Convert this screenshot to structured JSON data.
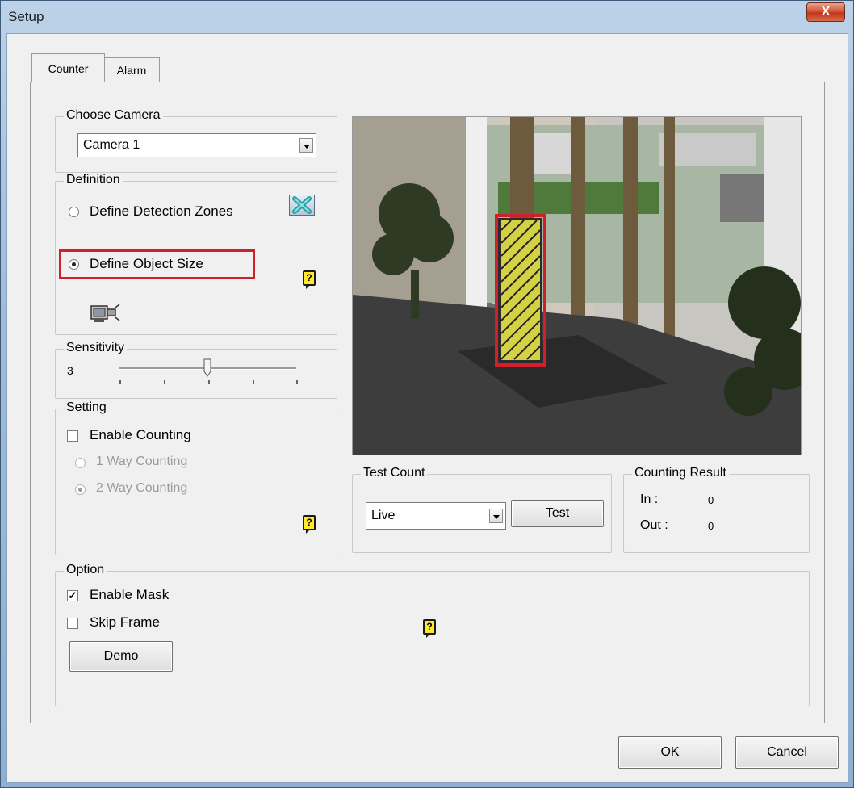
{
  "window": {
    "title": "Setup",
    "close_glyph": "X"
  },
  "tabs": [
    {
      "label": "Counter",
      "active": true
    },
    {
      "label": "Alarm",
      "active": false
    }
  ],
  "choose_camera": {
    "legend": "Choose Camera",
    "selected": "Camera 1"
  },
  "definition": {
    "legend": "Definition",
    "zones_label": "Define Detection Zones",
    "object_size_label": "Define Object Size",
    "zones_selected": false,
    "object_size_selected": true,
    "zones_icon": "clear-zones-icon",
    "object_icon": "camera-object-icon"
  },
  "sensitivity": {
    "legend": "Sensitivity",
    "value": "3",
    "slider_fraction": 0.5
  },
  "setting": {
    "legend": "Setting",
    "enable_counting": "Enable Counting",
    "one_way": "1 Way Counting",
    "two_way": "2 Way Counting"
  },
  "test_count": {
    "legend": "Test Count",
    "mode": "Live",
    "test_button": "Test"
  },
  "counting_result": {
    "legend": "Counting Result",
    "in_label": "In :",
    "in_value": "0",
    "out_label": "Out :",
    "out_value": "0"
  },
  "option": {
    "legend": "Option",
    "enable_mask": "Enable Mask",
    "skip_frame": "Skip Frame",
    "demo_button": "Demo",
    "check_glyph": "✓"
  },
  "footer": {
    "ok": "OK",
    "cancel": "Cancel"
  },
  "help_glyph": "?",
  "colors": {
    "highlight": "#d1202c",
    "help_bg": "#ffe92e"
  }
}
